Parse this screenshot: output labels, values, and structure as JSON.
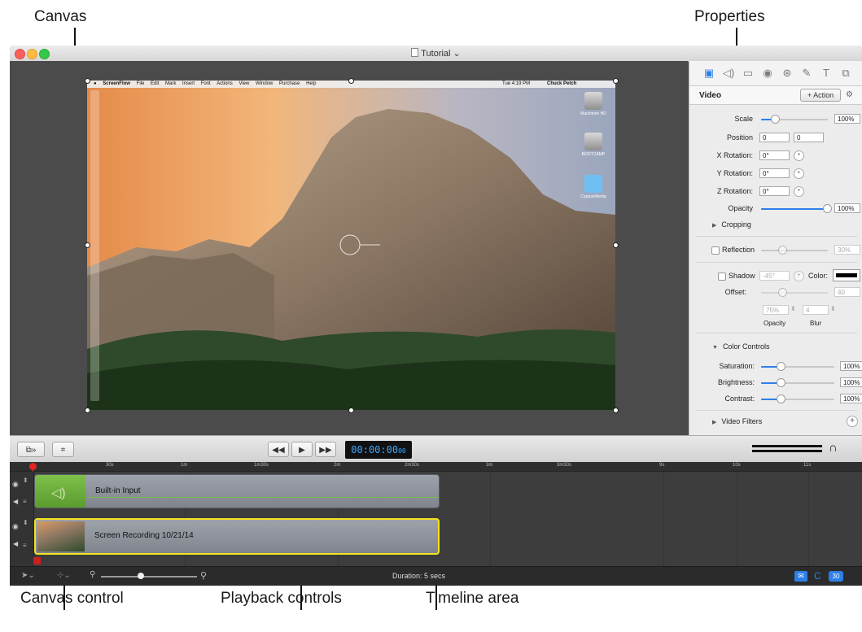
{
  "callouts": {
    "canvas": "Canvas",
    "properties": "Properties",
    "canvas_control": "Canvas control",
    "playback_controls": "Playback controls",
    "timeline_area": "Timeline area"
  },
  "window": {
    "title": "Tutorial"
  },
  "screen": {
    "menu_items": [
      "ScreenFlow",
      "File",
      "Edit",
      "Mark",
      "Insert",
      "Font",
      "Actions",
      "View",
      "Window",
      "Purchase",
      "Help"
    ],
    "clock": "Tue 4:19 PM",
    "user": "Chuck Petch",
    "desktop_icons": [
      "Macintosh HD",
      "BOOTCAMP",
      "CaptureMedia"
    ]
  },
  "properties": {
    "section": "Video",
    "action_button": "+ Action",
    "scale_label": "Scale",
    "scale_value": "100%",
    "scale_fraction": 0.2,
    "position_label": "Position",
    "position_x": "0",
    "position_y": "0",
    "x_rotation_label": "X Rotation:",
    "x_rotation": "0°",
    "y_rotation_label": "Y Rotation:",
    "y_rotation": "0°",
    "z_rotation_label": "Z Rotation:",
    "z_rotation": "0°",
    "opacity_label": "Opacity",
    "opacity_value": "100%",
    "cropping": "Cropping",
    "reflection_label": "Reflection",
    "reflection_value": "30%",
    "shadow_label": "Shadow",
    "shadow_angle": "-45°",
    "color_label": "Color:",
    "offset_label": "Offset:",
    "offset_value": "40",
    "shadow_opacity": "75%",
    "shadow_blur": "4",
    "opacity_sub": "Opacity",
    "blur_sub": "Blur",
    "color_controls": "Color Controls",
    "saturation_label": "Saturation:",
    "saturation_value": "100%",
    "brightness_label": "Brightness:",
    "brightness_value": "100%",
    "contrast_label": "Contrast:",
    "contrast_value": "100%",
    "video_filters": "Video Filters"
  },
  "toolbar": {
    "timecode_main": "00:00:00",
    "timecode_frames": "00"
  },
  "timeline": {
    "ticks": [
      "30s",
      "1m",
      "1m30s",
      "2m",
      "2m30s",
      "3m",
      "3m30s",
      "9s",
      "10s",
      "11s"
    ],
    "audio_clip": "Built-in Input",
    "video_clip": "Screen Recording 10/21/14",
    "duration": "Duration: 5 secs",
    "badge": "30"
  },
  "colors": {
    "accent": "#2e7fe8",
    "clip_selected_border": "#f2e21a",
    "timecode_text": "#3aa7ff"
  }
}
